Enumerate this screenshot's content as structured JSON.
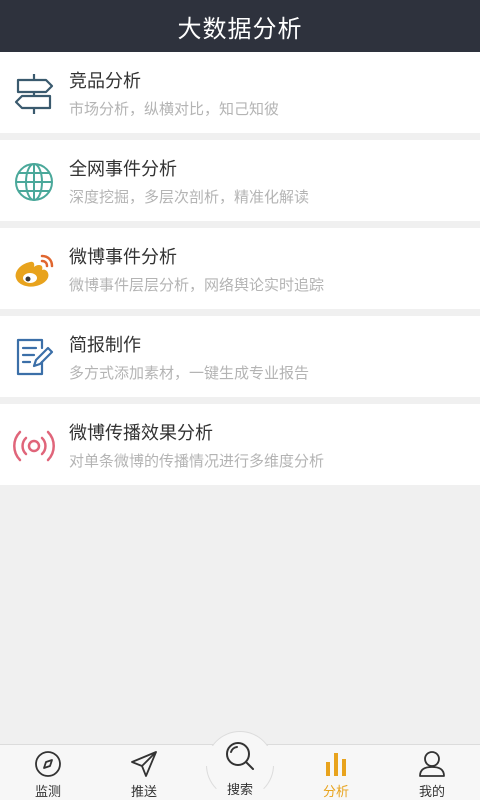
{
  "header": {
    "title": "大数据分析"
  },
  "items": [
    {
      "title": "竞品分析",
      "desc": "市场分析，纵横对比，知己知彼",
      "icon": "signpost-icon",
      "color": "#3a5a6e"
    },
    {
      "title": "全网事件分析",
      "desc": "深度挖掘，多层次剖析，精准化解读",
      "icon": "globe-icon",
      "color": "#4aa89a"
    },
    {
      "title": "微博事件分析",
      "desc": "微博事件层层分析，网络舆论实时追踪",
      "icon": "weibo-icon",
      "color": "#e8a31d"
    },
    {
      "title": "简报制作",
      "desc": "多方式添加素材，一键生成专业报告",
      "icon": "report-edit-icon",
      "color": "#3b6fa8"
    },
    {
      "title": "微博传播效果分析",
      "desc": "对单条微博的传播情况进行多维度分析",
      "icon": "broadcast-icon",
      "color": "#e0657a"
    }
  ],
  "tabs": [
    {
      "label": "监测",
      "icon": "compass-icon"
    },
    {
      "label": "推送",
      "icon": "send-icon"
    },
    {
      "label": "搜索",
      "icon": "search-icon"
    },
    {
      "label": "分析",
      "icon": "bar-chart-icon",
      "active": true
    },
    {
      "label": "我的",
      "icon": "user-icon"
    }
  ],
  "colors": {
    "header_bg": "#2e323d",
    "accent": "#e8a31d"
  }
}
